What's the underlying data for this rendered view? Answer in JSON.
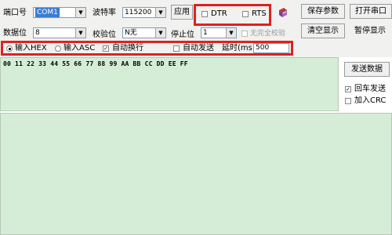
{
  "row1": {
    "port_label": "端口号",
    "port_value": "COM1",
    "baud_label": "波特率",
    "baud_value": "115200",
    "apply_label": "应用",
    "dtr_label": "DTR",
    "rts_label": "RTS",
    "save_params_label": "保存参数",
    "open_port_label": "打开串口"
  },
  "row2": {
    "databits_label": "数据位",
    "databits_value": "8",
    "parity_label": "校验位",
    "parity_value": "N无",
    "stopbits_label": "停止位",
    "stopbits_value": "1",
    "no_parity_label": "无完全校验",
    "clear_display_label": "清空显示",
    "pause_display_label": "暂停显示"
  },
  "row3": {
    "input_hex_label": "输入HEX",
    "input_asc_label": "输入ASC",
    "auto_wrap_label": "自动换行",
    "auto_send_label": "自动发送",
    "delay_label": "延时(ms",
    "delay_value": "500"
  },
  "send_area": {
    "hex_content": "00 11 22 33 44 55 66 77 88 99 AA BB CC DD EE FF",
    "send_data_label": "发送数据",
    "enter_send_label": "回车发送",
    "add_crc_label": "加入CRC"
  },
  "colors": {
    "panel_bg": "#f1f1ef",
    "text_area_bg": "#d5ecd6",
    "highlight_red": "#e02020"
  }
}
